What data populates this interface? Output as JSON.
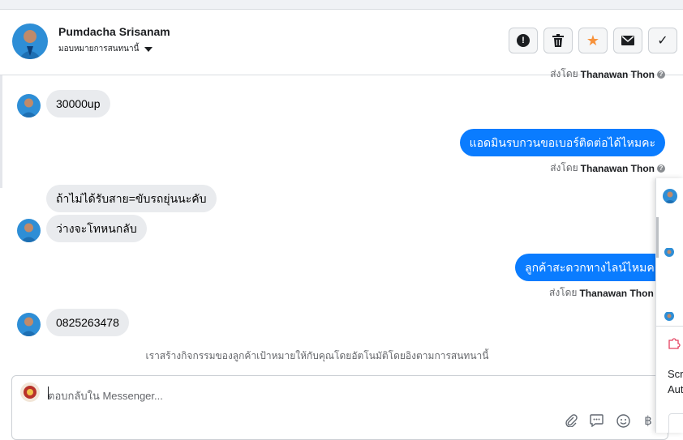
{
  "header": {
    "name": "Pumdacha Srisanam",
    "assign_label": "มอบหมายการสนทนานี้",
    "buttons": [
      {
        "name": "report-button",
        "icon": "exclamation-circle-icon",
        "glyph": "!"
      },
      {
        "name": "delete-button",
        "icon": "trash-icon",
        "glyph": "🗑"
      },
      {
        "name": "star-button",
        "icon": "star-icon",
        "glyph": "★"
      },
      {
        "name": "mark-unread-button",
        "icon": "envelope-icon",
        "glyph": "✉"
      },
      {
        "name": "mark-done-button",
        "icon": "check-icon",
        "glyph": "✓"
      }
    ]
  },
  "messages": {
    "top_sentby": {
      "prefix": "ส่งโดย",
      "sender": "Thanawan Thon"
    },
    "m1": "30000up",
    "m2": "แอดมินรบกวนขอเบอร์ติดต่อได้ไหมคะ",
    "m2_sentby": {
      "prefix": "ส่งโดย",
      "sender": "Thanawan Thon"
    },
    "m3": "ถ้าไม่ได้รับสาย=ขับรถยุ่นนะคับ",
    "m4": "ว่างจะโทหนกลับ",
    "m5": "ลูกค้าสะดวกทางไลน์ไหมคะ",
    "m5_sentby": {
      "prefix": "ส่งโดย",
      "sender": "Thanawan Thon"
    },
    "m6": "0825263478"
  },
  "system_message": "เราสร้างกิจกรรมของลูกค้าเป้าหมายให้กับคุณโดยอัตโนมัติโดยอิงตามการสนทนานี้",
  "composer": {
    "placeholder": "ตอบกลับใน Messenger...",
    "tools": [
      "paperclip-icon",
      "saved-reply-icon",
      "emoji-icon",
      "baht-icon"
    ],
    "baht_glyph": "฿"
  },
  "side_panel": {
    "line1": "Scr",
    "line2": "Aut"
  },
  "colors": {
    "accent": "#0a7cff",
    "incoming_bubble": "#e9ebee",
    "star": "#f7923b"
  }
}
